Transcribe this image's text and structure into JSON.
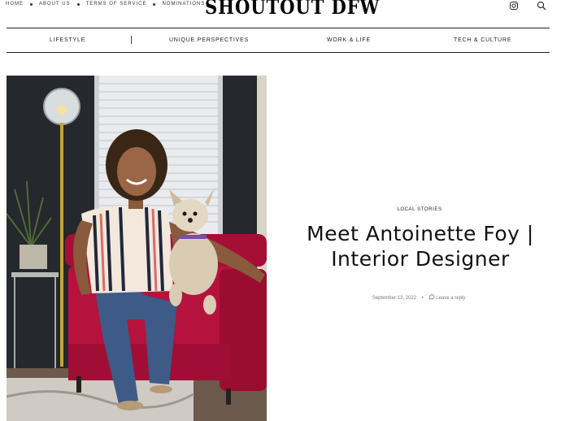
{
  "top_nav": {
    "items": [
      "HOME",
      "ABOUT US",
      "TERMS OF SERVICE",
      "NOMINATIONS"
    ]
  },
  "site": {
    "logo_text": "SHOUTOUT DFW"
  },
  "header_icons": [
    "instagram-icon",
    "search-icon"
  ],
  "main_menu": {
    "items": [
      "LIFESTYLE",
      "UNIQUE PERSPECTIVES",
      "WORK & LIFE",
      "TECH & CULTURE"
    ]
  },
  "article": {
    "category": "LOCAL STORIES",
    "title_line1": "Meet Antoinette Foy |",
    "title_line2": "Interior Designer",
    "date": "September 13, 2022",
    "comment_link": "Leave a reply"
  },
  "colors": {
    "text": "#111111",
    "meta": "#777777",
    "chair": "#b5123d"
  }
}
